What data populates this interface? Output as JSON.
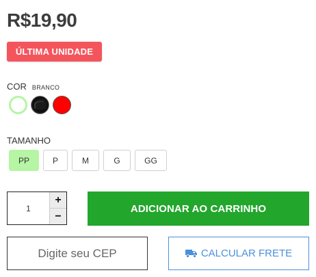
{
  "product": {
    "price": "R$19,90",
    "badge": "ÚLTIMA UNIDADE"
  },
  "color": {
    "label": "COR",
    "selected": "BRANCO",
    "swatches": [
      {
        "name": "branco",
        "hex": "#ffffff",
        "selected": true
      },
      {
        "name": "preto",
        "hex": "#111111",
        "selected": false
      },
      {
        "name": "vermelho",
        "hex": "#ff0000",
        "selected": false
      }
    ]
  },
  "size": {
    "label": "TAMANHO",
    "options": [
      "PP",
      "P",
      "M",
      "G",
      "GG"
    ],
    "selected": "PP"
  },
  "quantity": {
    "value": "1",
    "plus": "+",
    "minus": "−"
  },
  "actions": {
    "add_to_cart": "ADICIONAR AO CARRINHO",
    "cep_placeholder": "Digite seu CEP",
    "calculate_shipping": "CALCULAR FRETE",
    "shipping_icon": "truck-icon"
  },
  "colors": {
    "badge_bg": "#f4555d",
    "selected_accent": "#b5f5a4",
    "add_cart_bg": "#22a62c",
    "shipping_blue": "#4a90d9"
  }
}
